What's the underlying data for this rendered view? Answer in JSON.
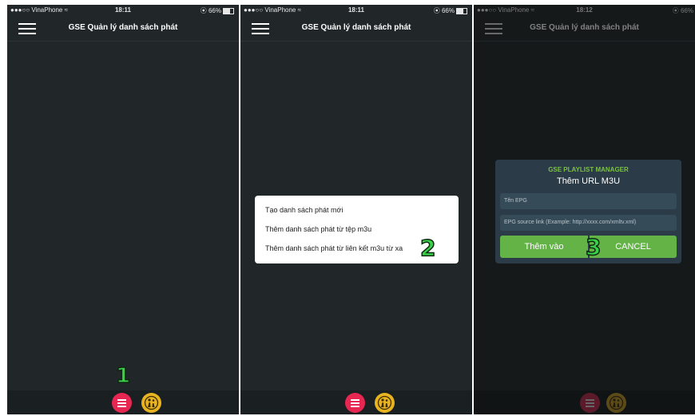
{
  "status": {
    "carrier": "●●●○○ VinaPhone ≈",
    "battery": "⦿ 66%"
  },
  "panels": [
    {
      "time": "18:11",
      "title": "GSE Quản lý danh sách phát",
      "step": "1"
    },
    {
      "time": "18:11",
      "title": "GSE Quản lý danh sách phát",
      "step": "2"
    },
    {
      "time": "18:12",
      "title": "GSE Quản lý danh sách phát",
      "step": "3"
    }
  ],
  "menu": {
    "items": [
      "Tạo danh sách phát mới",
      "Thêm danh sách phát từ tệp m3u",
      "Thêm danh sách phát từ liên kết m3u từ xa"
    ]
  },
  "dialog": {
    "brand": "GSE PLAYLIST MANAGER",
    "title": "Thêm URL M3U",
    "name_placeholder": "Tên EPG",
    "link_placeholder": "EPG source link (Example: http://xxxx.com/xmltv.xml)",
    "add_label": "Thêm vào",
    "cancel_label": "CANCEL"
  },
  "icons": {
    "menu": "hamburger-icon",
    "fab_menu": "list-icon",
    "fab_kids": "kids-icon"
  },
  "colors": {
    "background": "#212729",
    "accent_red": "#e52752",
    "accent_yellow": "#e8b321",
    "button_green": "#63b346",
    "step_green": "#3ad04a"
  }
}
